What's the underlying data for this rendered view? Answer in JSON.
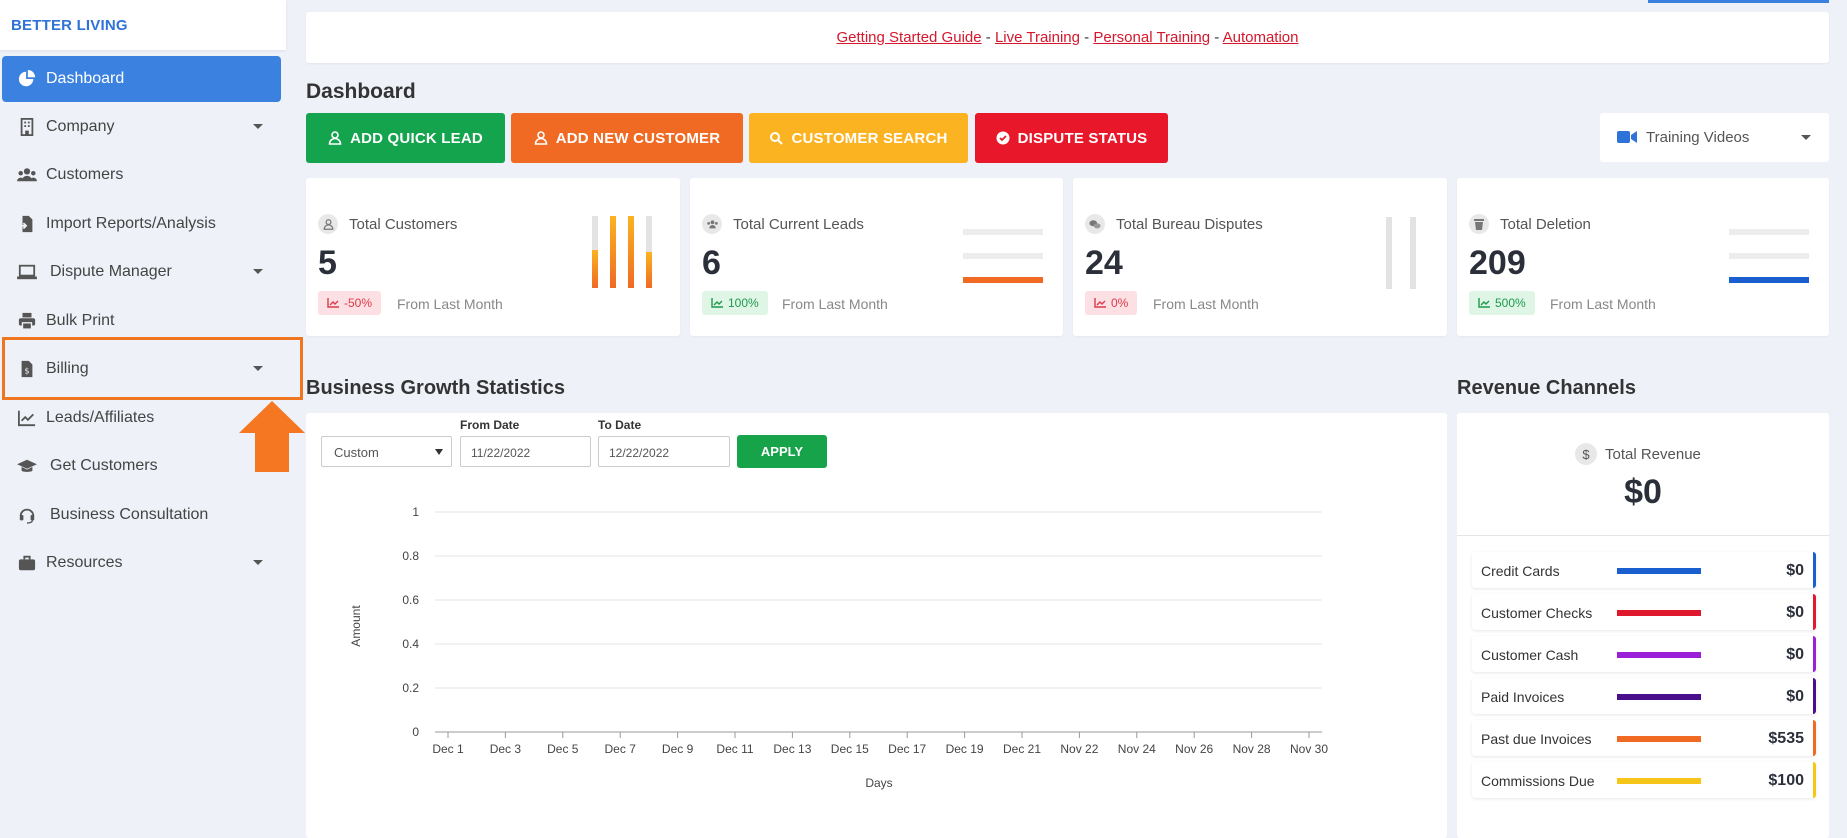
{
  "brand": "BETTER LIVING",
  "sidebar": {
    "items": [
      {
        "label": "Dashboard",
        "icon": "pie-chart-icon"
      },
      {
        "label": "Company",
        "icon": "building-icon"
      },
      {
        "label": "Customers",
        "icon": "users-icon"
      },
      {
        "label": "Import Reports/Analysis",
        "icon": "file-import-icon"
      },
      {
        "label": "Dispute Manager",
        "icon": "laptop-icon"
      },
      {
        "label": "Bulk Print",
        "icon": "printer-icon"
      },
      {
        "label": "Billing",
        "icon": "invoice-icon"
      },
      {
        "label": "Leads/Affiliates",
        "icon": "trend-chart-icon"
      },
      {
        "label": "Get Customers",
        "icon": "graduation-cap-icon"
      },
      {
        "label": "Business Consultation",
        "icon": "headset-icon"
      },
      {
        "label": "Resources",
        "icon": "briefcase-icon"
      }
    ]
  },
  "topbar": {
    "links": [
      "Getting Started Guide",
      "Live Training",
      "Personal Training",
      "Automation"
    ],
    "separator": "-"
  },
  "page_title": "Dashboard",
  "actions": {
    "add_quick_lead": "ADD QUICK LEAD",
    "add_new_customer": "ADD NEW CUSTOMER",
    "customer_search": "CUSTOMER SEARCH",
    "dispute_status": "DISPUTE STATUS"
  },
  "training_videos": "Training Videos",
  "stats": [
    {
      "title": "Total Customers",
      "value": "5",
      "change": "-50%",
      "from": "From Last Month"
    },
    {
      "title": "Total Current Leads",
      "value": "6",
      "change": "100%",
      "from": "From Last Month"
    },
    {
      "title": "Total Bureau Disputes",
      "value": "24",
      "change": "0%",
      "from": "From Last Month"
    },
    {
      "title": "Total Deletion",
      "value": "209",
      "change": "500%",
      "from": "From Last Month"
    }
  ],
  "growth": {
    "title": "Business Growth Statistics",
    "range_select": "Custom",
    "from_label": "From Date",
    "from_value": "11/22/2022",
    "to_label": "To Date",
    "to_value": "12/22/2022",
    "apply": "APPLY"
  },
  "chart_data": {
    "type": "line",
    "xlabel": "Days",
    "ylabel": "Amount",
    "categories": [
      "Dec 1",
      "Dec 3",
      "Dec 5",
      "Dec 7",
      "Dec 9",
      "Dec 11",
      "Dec 13",
      "Dec 15",
      "Dec 17",
      "Dec 19",
      "Dec 21",
      "Nov 22",
      "Nov 24",
      "Nov 26",
      "Nov 28",
      "Nov 30"
    ],
    "yticks": [
      "0",
      "0.2",
      "0.4",
      "0.6",
      "0.8",
      "1"
    ],
    "ylim": [
      0,
      1
    ],
    "grid": true,
    "series": []
  },
  "revenue": {
    "title": "Revenue Channels",
    "total_label": "Total Revenue",
    "total_icon": "$",
    "total_value": "$0",
    "channels": [
      {
        "name": "Credit Cards",
        "value": "$0",
        "color": "#1a5fd0"
      },
      {
        "name": "Customer Checks",
        "value": "$0",
        "color": "#e0182d"
      },
      {
        "name": "Customer Cash",
        "value": "$0",
        "color": "#9b1ed8"
      },
      {
        "name": "Paid Invoices",
        "value": "$0",
        "color": "#4a0f8c"
      },
      {
        "name": "Past due Invoices",
        "value": "$535",
        "color": "#f06a23"
      },
      {
        "name": "Commissions Due",
        "value": "$100",
        "color": "#f5c518"
      }
    ]
  }
}
